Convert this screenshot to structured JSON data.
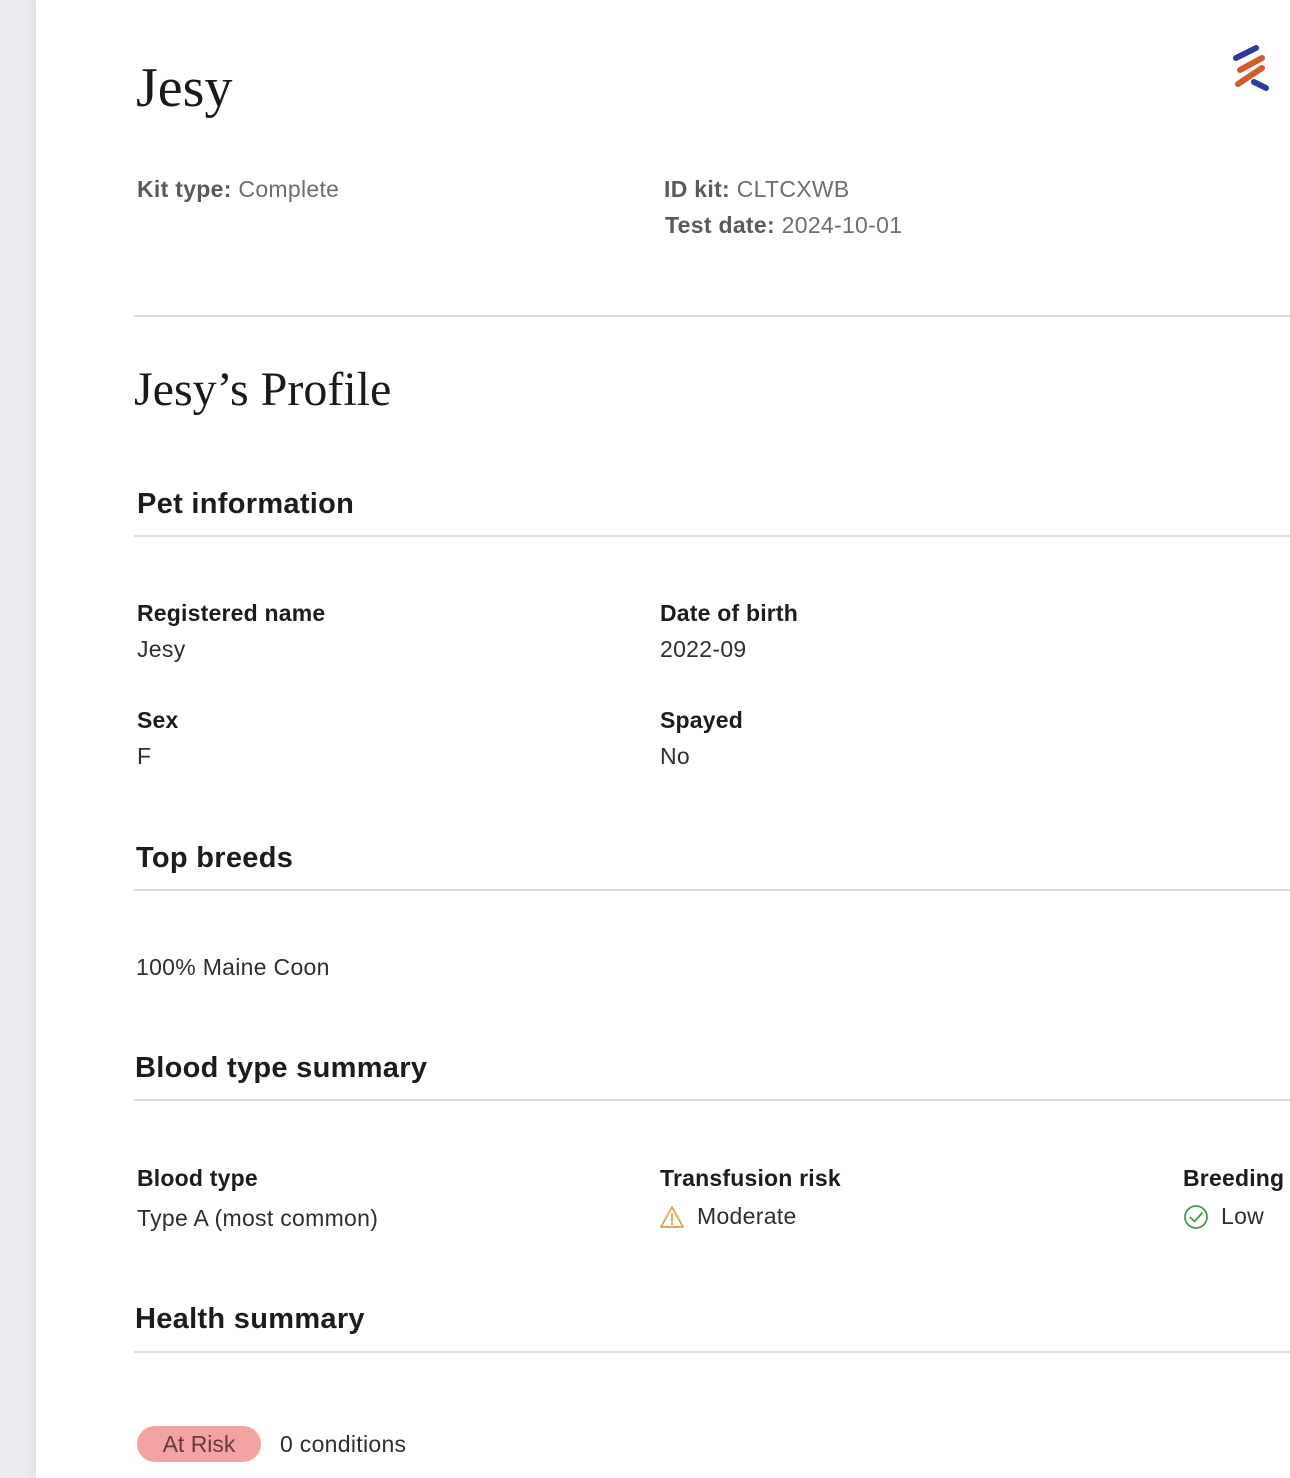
{
  "header": {
    "pet_name": "Jesy",
    "kit_type_label": "Kit type:",
    "kit_type_value": "Complete",
    "id_kit_label": "ID kit:",
    "id_kit_value": "CLTCXWB",
    "test_date_label": "Test date:",
    "test_date_value": "2024-10-01",
    "logo_icon": "brand-logo-icon"
  },
  "profile": {
    "title": "Jesy’s Profile"
  },
  "pet_information": {
    "title": "Pet information",
    "fields": [
      {
        "label": "Registered name",
        "value": "Jesy"
      },
      {
        "label": "Date of birth",
        "value": "2022-09"
      },
      {
        "label": "Sex",
        "value": "F"
      },
      {
        "label": "Spayed",
        "value": "No"
      }
    ]
  },
  "top_breeds": {
    "title": "Top breeds",
    "value": "100% Maine Coon"
  },
  "blood_type_summary": {
    "title": "Blood type summary",
    "blood_type_label": "Blood type",
    "blood_type_value": "Type A (most common)",
    "transfusion_label": "Transfusion risk",
    "transfusion_value": "Moderate",
    "transfusion_icon": "warning-triangle-icon",
    "breeding_label": "Breeding",
    "breeding_value": "Low",
    "breeding_icon": "check-circle-icon"
  },
  "health_summary": {
    "title": "Health summary",
    "badge": "At Risk",
    "conditions": "0 conditions"
  },
  "colors": {
    "warning": "#d9a441",
    "success": "#3f9a4a",
    "risk_badge": "#f4a3a3",
    "logo_blue": "#2d3a9e",
    "logo_orange": "#d45a2c"
  }
}
